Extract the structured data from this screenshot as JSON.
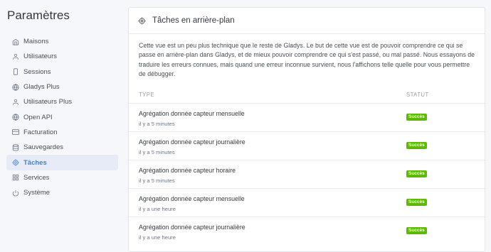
{
  "sidebar": {
    "title": "Paramètres",
    "items": [
      {
        "label": "Maisons",
        "icon": "home-icon"
      },
      {
        "label": "Utilisateurs",
        "icon": "user-icon"
      },
      {
        "label": "Sessions",
        "icon": "phone-icon"
      },
      {
        "label": "Gladys Plus",
        "icon": "globe-icon"
      },
      {
        "label": "Utilisateurs Plus",
        "icon": "user-icon"
      },
      {
        "label": "Open API",
        "icon": "globe-icon"
      },
      {
        "label": "Facturation",
        "icon": "credit-card-icon"
      },
      {
        "label": "Sauvegardes",
        "icon": "database-icon"
      },
      {
        "label": "Tâches",
        "icon": "settings-icon",
        "active": true
      },
      {
        "label": "Services",
        "icon": "grid-icon"
      },
      {
        "label": "Système",
        "icon": "power-icon"
      }
    ]
  },
  "card": {
    "title": "Tâches en arrière-plan",
    "description": "Cette vue est un peu plus technique que le reste de Gladys. Le but de cette vue est de pouvoir comprendre ce qui se passe en arrière-plan dans Gladys, et de mieux pouvoir comprendre ce qui s'est passé, ou mal passé. Nous essayons de traduire les erreurs connues, mais quand une erreur inconnue survient, nous l'affichons telle quelle pour vous permettre de débugger.",
    "columns": {
      "type": "TYPE",
      "status": "STATUT"
    },
    "rows": [
      {
        "name": "Agrégation donnée capteur mensuelle",
        "time": "il y a 5 minutes",
        "status": "Succès"
      },
      {
        "name": "Agrégation donnée capteur journalière",
        "time": "il y a 5 minutes",
        "status": "Succès"
      },
      {
        "name": "Agrégation donnée capteur horaire",
        "time": "il y a 5 minutes",
        "status": "Succès"
      },
      {
        "name": "Agrégation donnée capteur mensuelle",
        "time": "il y a une heure",
        "status": "Succès"
      },
      {
        "name": "Agrégation donnée capteur journalière",
        "time": "il y a une heure",
        "status": "Succès"
      }
    ]
  },
  "colors": {
    "accent": "#467fcf",
    "success": "#5eba00",
    "active_bg": "#e6ebf7"
  }
}
